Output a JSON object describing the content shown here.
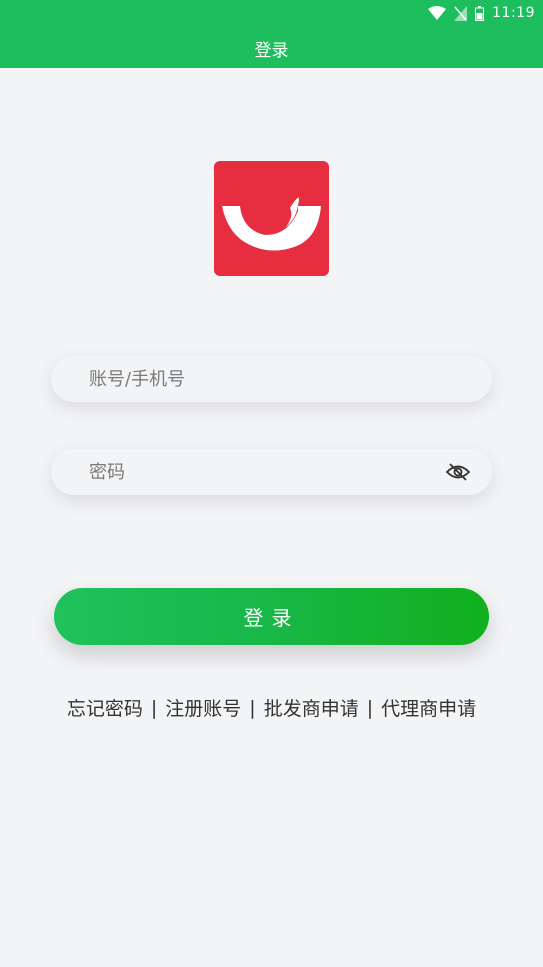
{
  "status_bar": {
    "time": "11:19",
    "icons": [
      "wifi-icon",
      "no-sim-icon",
      "battery-icon"
    ]
  },
  "header": {
    "title": "登录",
    "background_color": "#1ebe5e"
  },
  "logo": {
    "icon": "smile-logo-icon",
    "background_color": "#e62e40"
  },
  "form": {
    "username_placeholder": "账号/手机号",
    "username_value": "",
    "password_placeholder": "密码",
    "password_value": "",
    "password_toggle_icon": "eye-off-icon"
  },
  "login_button": {
    "label": "登录",
    "gradient_start": "#21c15c",
    "gradient_end": "#10b01e"
  },
  "links": {
    "forgot_password": "忘记密码",
    "register": "注册账号",
    "wholesaler_apply": "批发商申请",
    "agent_apply": "代理商申请",
    "separator": "|"
  }
}
